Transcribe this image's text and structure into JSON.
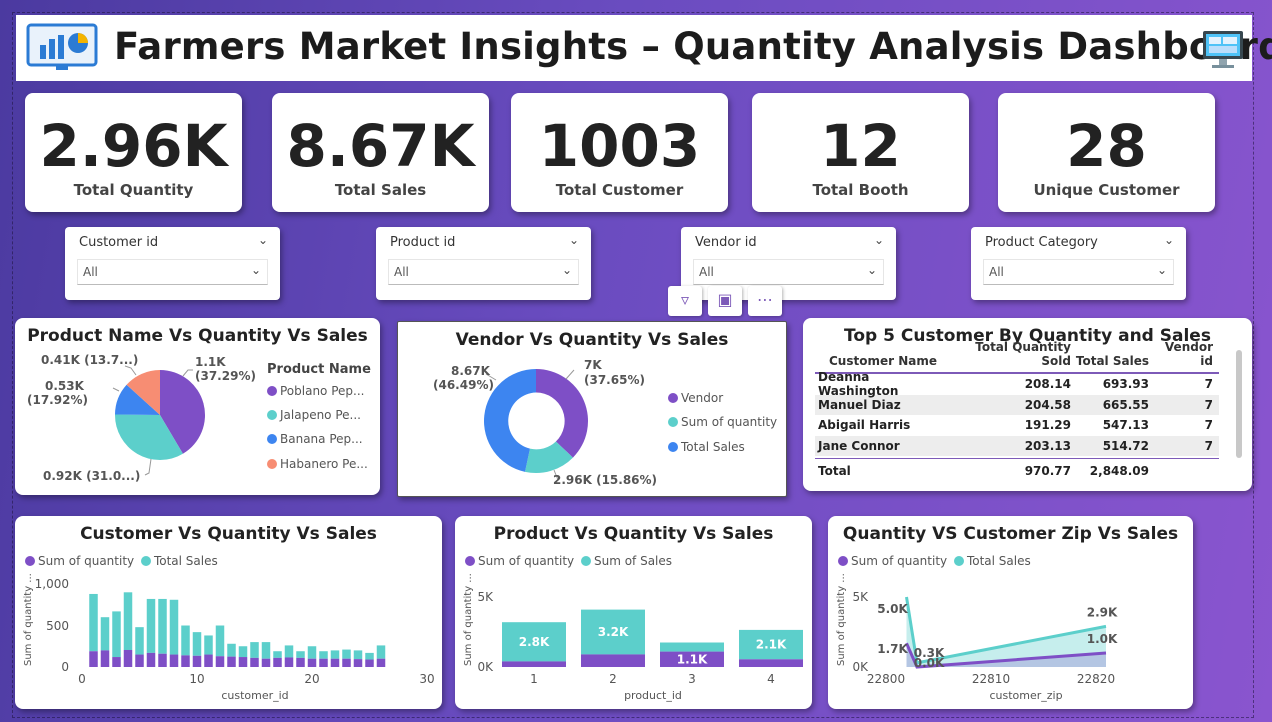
{
  "dashboard": {
    "title": "Farmers Market Insights – Quantity Analysis Dashboard"
  },
  "kpis": [
    {
      "value": "2.96K",
      "label": "Total Quantity"
    },
    {
      "value": "8.67K",
      "label": "Total Sales"
    },
    {
      "value": "1003",
      "label": "Total Customer"
    },
    {
      "value": "12",
      "label": "Total Booth"
    },
    {
      "value": "28",
      "label": "Unique Customer"
    }
  ],
  "slicers": [
    {
      "title": "Customer id",
      "value": "All"
    },
    {
      "title": "Product id",
      "value": "All"
    },
    {
      "title": "Vendor id",
      "value": "All"
    },
    {
      "title": "Product Category",
      "value": "All"
    }
  ],
  "colors": {
    "purple": "#7e4fc6",
    "teal": "#5ccfcb",
    "blue": "#3d85f0",
    "salmon": "#f78d73"
  },
  "product_pie": {
    "title": "Product Name Vs Quantity Vs Sales",
    "legend_title": "Product Name",
    "legend": [
      "Poblano Pep...",
      "Jalapeno Pe...",
      "Banana Pep...",
      "Habanero Pe..."
    ],
    "labels": {
      "poblano": [
        "1.1K",
        "(37.29%)"
      ],
      "jalapeno": "0.92K (31.0...)",
      "banana": [
        "0.53K",
        "(17.92%)"
      ],
      "habanero": "0.41K (13.7...)"
    }
  },
  "vendor_donut": {
    "title": "Vendor Vs Quantity Vs Sales",
    "legend": [
      "Vendor",
      "Sum of quantity",
      "Total Sales"
    ],
    "labels": {
      "vendor": [
        "7K",
        "(37.65%)"
      ],
      "quantity": "2.96K (15.86%)",
      "sales": [
        "8.67K",
        "(46.49%)"
      ]
    }
  },
  "top_customers": {
    "title": "Top 5 Customer By Quantity and Sales",
    "columns": [
      "Customer Name",
      "Total Quantity Sold",
      "Total Sales",
      "Vendor id"
    ],
    "rows": [
      [
        "Deanna Washington",
        "208.14",
        "693.93",
        "7"
      ],
      [
        "Manuel Diaz",
        "204.58",
        "665.55",
        "7"
      ],
      [
        "Abigail Harris",
        "191.29",
        "547.13",
        "7"
      ],
      [
        "Jane Connor",
        "203.13",
        "514.72",
        "7"
      ]
    ],
    "total": [
      "Total",
      "970.77",
      "2,848.09",
      ""
    ]
  },
  "customer_chart": {
    "title": "Customer Vs Quantity Vs Sales",
    "legend": [
      "Sum of quantity",
      "Total Sales"
    ],
    "ylabel": "Sum of quantity ...",
    "xlabel": "customer_id",
    "yticks": [
      "0",
      "500",
      "1,000"
    ],
    "xticks": [
      "0",
      "10",
      "20",
      "30"
    ]
  },
  "product_chart": {
    "title": "Product Vs Quantity Vs Sales",
    "legend": [
      "Sum of quantity",
      "Sum of Sales"
    ],
    "ylabel": "Sum of quantity ...",
    "xlabel": "product_id",
    "yticks": [
      "0K",
      "5K"
    ],
    "xticks": [
      "1",
      "2",
      "3",
      "4"
    ],
    "bar_labels": [
      "2.8K",
      "3.2K",
      "1.1K",
      "2.1K"
    ]
  },
  "zip_chart": {
    "title": "Quantity VS Customer Zip Vs Sales",
    "legend": [
      "Sum of quantity",
      "Total Sales"
    ],
    "ylabel": "Sum of quantity ...",
    "xlabel": "customer_zip",
    "yticks": [
      "0K",
      "5K"
    ],
    "xticks": [
      "22800",
      "22810",
      "22820"
    ],
    "point_labels": [
      "5.0K",
      "1.7K",
      "0.3K",
      "0.0K",
      "2.9K",
      "1.0K"
    ]
  },
  "chart_data": [
    {
      "type": "bar",
      "title": "Customer Vs Quantity Vs Sales",
      "xlabel": "customer_id",
      "ylabel": "Sum of quantity ...",
      "ylim": [
        0,
        1000
      ],
      "x": [
        1,
        2,
        3,
        4,
        5,
        6,
        7,
        8,
        9,
        10,
        11,
        12,
        13,
        14,
        15,
        16,
        17,
        18,
        19,
        20,
        21,
        22,
        23,
        24,
        25,
        26
      ],
      "series": [
        {
          "name": "Sum of quantity",
          "values": [
            190,
            200,
            120,
            205,
            150,
            170,
            160,
            150,
            140,
            135,
            150,
            130,
            125,
            120,
            110,
            100,
            110,
            115,
            110,
            100,
            100,
            100,
            100,
            95,
            90,
            100
          ]
        },
        {
          "name": "Total Sales",
          "values": [
            880,
            600,
            670,
            900,
            480,
            820,
            820,
            810,
            500,
            420,
            380,
            500,
            280,
            250,
            300,
            300,
            190,
            260,
            190,
            250,
            190,
            200,
            210,
            200,
            170,
            260
          ]
        }
      ]
    },
    {
      "type": "bar",
      "title": "Product Vs Quantity Vs Sales",
      "xlabel": "product_id",
      "ylabel": "Sum of quantity ...",
      "categories": [
        "1",
        "2",
        "3",
        "4"
      ],
      "series": [
        {
          "name": "Sum of quantity",
          "values": [
            400,
            900,
            1100,
            550
          ]
        },
        {
          "name": "Sum of Sales",
          "values": [
            2800,
            3200,
            650,
            2100
          ]
        }
      ]
    },
    {
      "type": "area",
      "title": "Quantity VS Customer Zip Vs Sales",
      "xlabel": "customer_zip",
      "ylabel": "Sum of quantity ...",
      "x": [
        22801,
        22802,
        22820
      ],
      "series": [
        {
          "name": "Sum of quantity",
          "values": [
            1700,
            0,
            1000
          ]
        },
        {
          "name": "Total Sales",
          "values": [
            5000,
            300,
            2900
          ]
        }
      ]
    },
    {
      "type": "pie",
      "title": "Product Name Vs Quantity Vs Sales",
      "categories": [
        "Poblano Pep...",
        "Jalapeno Pe...",
        "Banana Pep...",
        "Habanero Pe..."
      ],
      "values": [
        1.1,
        0.92,
        0.53,
        0.41
      ],
      "percent": [
        37.29,
        31.0,
        17.92,
        13.7
      ]
    },
    {
      "type": "pie",
      "title": "Vendor Vs Quantity Vs Sales",
      "categories": [
        "Vendor",
        "Sum of quantity",
        "Total Sales"
      ],
      "values": [
        7,
        2.96,
        8.67
      ],
      "percent": [
        37.65,
        15.86,
        46.49
      ]
    }
  ]
}
